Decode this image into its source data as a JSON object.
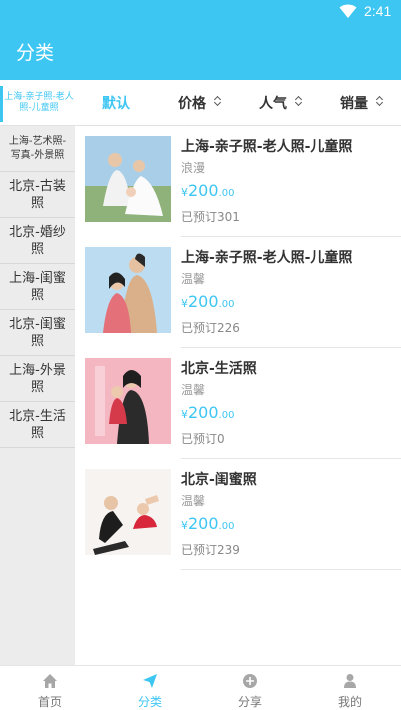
{
  "status": {
    "time": "2:41"
  },
  "header": {
    "title": "分类"
  },
  "filter": {
    "current_category": "上海-亲子照-老人照-儿童照",
    "sorts": [
      {
        "label": "默认",
        "active": true
      },
      {
        "label": "价格",
        "active": false
      },
      {
        "label": "人气",
        "active": false
      },
      {
        "label": "销量",
        "active": false
      }
    ]
  },
  "sidebar": {
    "items": [
      {
        "label": "上海-艺术照-写真-外景照"
      },
      {
        "label": "北京-古装照"
      },
      {
        "label": "北京-婚纱照"
      },
      {
        "label": "上海-闺蜜照"
      },
      {
        "label": "北京-闺蜜照"
      },
      {
        "label": "上海-外景照"
      },
      {
        "label": "北京-生活照"
      }
    ]
  },
  "products": [
    {
      "title": "上海-亲子照-老人照-儿童照",
      "style": "浪漫",
      "currency": "¥",
      "price_int": "200",
      "price_cents": ".00",
      "booked": "已预订301"
    },
    {
      "title": "上海-亲子照-老人照-儿童照",
      "style": "温馨",
      "currency": "¥",
      "price_int": "200",
      "price_cents": ".00",
      "booked": "已预订226"
    },
    {
      "title": "北京-生活照",
      "style": "温馨",
      "currency": "¥",
      "price_int": "200",
      "price_cents": ".00",
      "booked": "已预订0"
    },
    {
      "title": "北京-闺蜜照",
      "style": "温馨",
      "currency": "¥",
      "price_int": "200",
      "price_cents": ".00",
      "booked": "已预订239"
    }
  ],
  "tabbar": {
    "tabs": [
      {
        "label": "首页",
        "icon": "home-icon",
        "active": false
      },
      {
        "label": "分类",
        "icon": "send-icon",
        "active": true
      },
      {
        "label": "分享",
        "icon": "share-icon",
        "active": false
      },
      {
        "label": "我的",
        "icon": "user-icon",
        "active": false
      }
    ]
  },
  "colors": {
    "accent": "#3ec6f3",
    "sidebar_bg": "#ececec"
  }
}
